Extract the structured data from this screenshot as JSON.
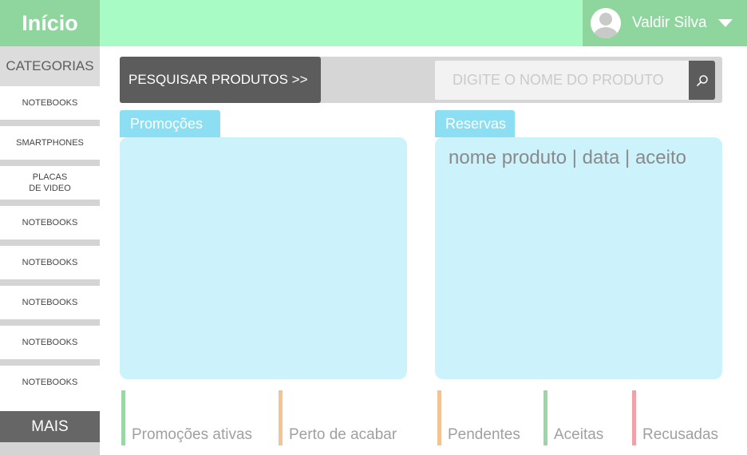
{
  "header": {
    "brand": "Início",
    "user_name": "Valdir Silva"
  },
  "sidebar": {
    "title": "CATEGORIAS",
    "items": [
      {
        "label": "NOTEBOOKS"
      },
      {
        "label": "SMARTPHONES"
      },
      {
        "label": "PLACAS\nDE VIDEO"
      },
      {
        "label": "NOTEBOOKS"
      },
      {
        "label": "NOTEBOOKS"
      },
      {
        "label": "NOTEBOOKS"
      },
      {
        "label": "NOTEBOOKS"
      },
      {
        "label": "NOTEBOOKS"
      }
    ],
    "more_label": "MAIS"
  },
  "search": {
    "label": "PESQUISAR PRODUTOS >>",
    "placeholder": "DIGITE O NOME DO PRODUTO",
    "icon": "search-icon"
  },
  "promotions": {
    "tab_label": "Promoções"
  },
  "reservations": {
    "tab_label": "Reservas",
    "header_text": "nome produto | data | aceito"
  },
  "stats": [
    {
      "label": "Promoções ativas",
      "color": "#9ad7a4"
    },
    {
      "label": "Perto de acabar",
      "color": "#f3c493"
    },
    {
      "label": "Pendentes",
      "color": "#f3c493"
    },
    {
      "label": "Aceitas",
      "color": "#9ad7a4"
    },
    {
      "label": "Recusadas",
      "color": "#f4a0a8"
    }
  ],
  "colors": {
    "brand_green": "#8fd59e",
    "topbar_green": "#a9fbc6",
    "panel_blue": "#ccf2fc",
    "tab_blue": "#8cdff2",
    "dark_gray": "#5c5c5c"
  }
}
